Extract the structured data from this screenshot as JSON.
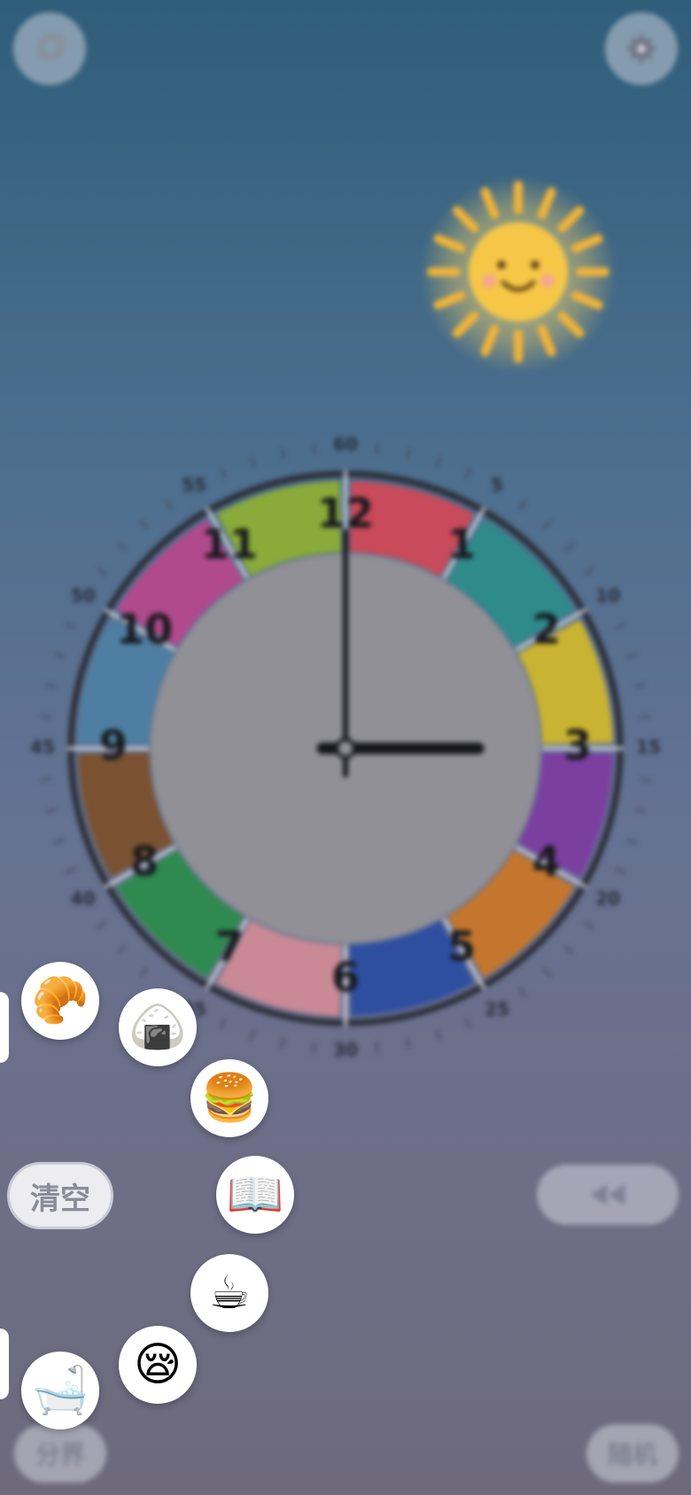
{
  "top_bar": {
    "left_icon": "window-icon",
    "right_icon": "gear-icon"
  },
  "sun": {
    "icon": "smiling-sun-icon",
    "color": "#f5c542"
  },
  "clock": {
    "hour_numbers": [
      "12",
      "1",
      "2",
      "3",
      "4",
      "5",
      "6",
      "7",
      "8",
      "9",
      "10",
      "11"
    ],
    "minute_labels": [
      "60",
      "5",
      "10",
      "15",
      "20",
      "25",
      "30",
      "35",
      "40",
      "45",
      "50",
      "55"
    ],
    "segment_colors": [
      "#c94a5a",
      "#2e8b8a",
      "#c9b332",
      "#7b3fa0",
      "#c4762e",
      "#2e4fa0",
      "#c98a96",
      "#2e8a4f",
      "#7a5232",
      "#4e7fa2",
      "#b04a8c",
      "#8aab3a"
    ],
    "hour_hand_value": 3,
    "minute_hand_value": 0
  },
  "radial_menu": {
    "items": [
      {
        "name": "croissant",
        "emoji": "🥐"
      },
      {
        "name": "rice-ball",
        "emoji": "🍙"
      },
      {
        "name": "burger",
        "emoji": "🍔"
      },
      {
        "name": "book",
        "emoji": "📖"
      },
      {
        "name": "coffee",
        "emoji": "☕"
      },
      {
        "name": "sleepy",
        "emoji": "😪"
      },
      {
        "name": "bathtub",
        "emoji": "🛁"
      }
    ],
    "clear_label": "清空"
  },
  "controls": {
    "rewind_icon": "rewind-icon",
    "bottom_left_label": "分界",
    "bottom_right_label": "随机"
  }
}
